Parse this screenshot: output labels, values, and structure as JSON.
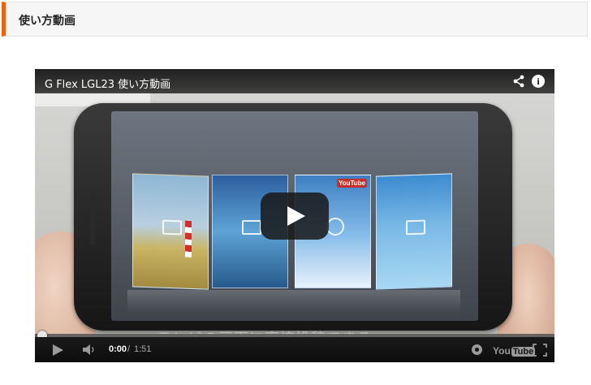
{
  "section": {
    "title": "使い方動画",
    "accent_color": "#e8650f"
  },
  "video": {
    "title": "G Flex LGL23 使い方動画",
    "subtitle_overlay": "テレビの画面に直接投稿できる",
    "current_time": "0:00",
    "time_separator": "/",
    "duration": "1:51",
    "progress": 0.0,
    "thumbnail_badge": "YouTube",
    "logo_you": "You",
    "logo_tube": "Tube",
    "icons": {
      "share": "share-icon",
      "info": "info-icon",
      "play_overlay": "play-icon",
      "play": "play-icon",
      "volume": "volume-icon",
      "settings": "settings-icon",
      "fullscreen": "fullscreen-icon"
    },
    "play_button_color": "#181818"
  }
}
